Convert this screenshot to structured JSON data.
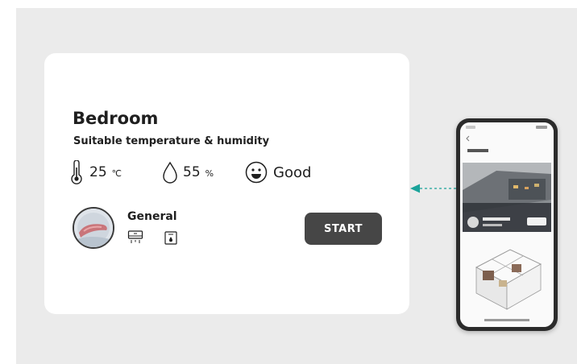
{
  "room": {
    "title": "Bedroom",
    "subtitle": "Suitable temperature & humidity"
  },
  "stats": {
    "temperature": {
      "value": "25",
      "unit": "℃",
      "icon": "thermometer-icon"
    },
    "humidity": {
      "value": "55",
      "unit": "%",
      "icon": "water-drop-icon"
    },
    "air_quality": {
      "value": "Good",
      "icon": "smiley-face-icon"
    }
  },
  "mode": {
    "name": "General",
    "icons": [
      "air-conditioner-icon",
      "dehumidifier-icon"
    ]
  },
  "start_button": {
    "label": "START"
  },
  "colors": {
    "background": "#ebebeb",
    "card": "#ffffff",
    "button": "#464646",
    "arrow": "#1aa39a",
    "text": "#1f1f1f"
  }
}
